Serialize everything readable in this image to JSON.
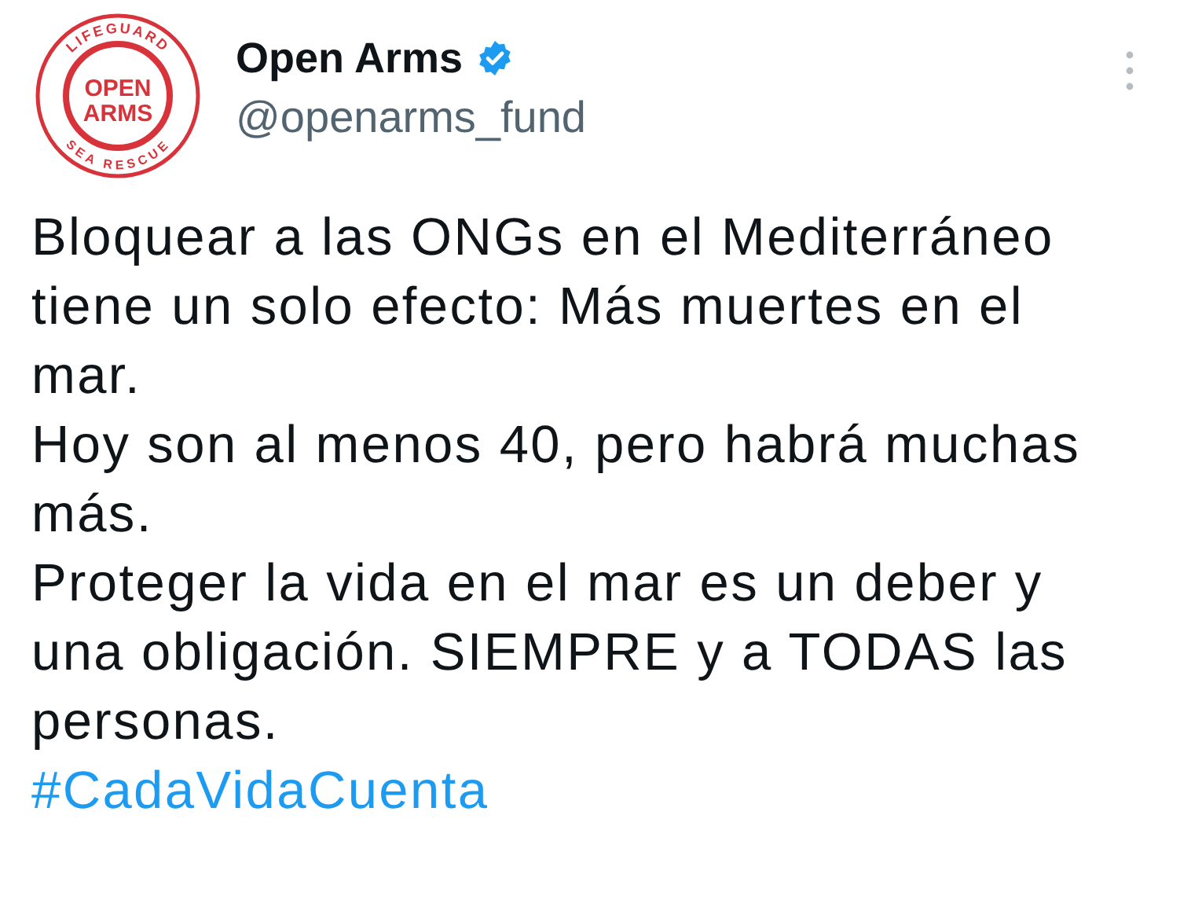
{
  "author": {
    "logo": {
      "top_ring": "LIFEGUARD",
      "bottom_ring": "SEA RESCUE",
      "line_1": "OPEN",
      "line_2": "ARMS"
    },
    "name": "Open Arms",
    "verified": true,
    "handle": "@openarms_fund"
  },
  "paragraphs": [
    "Bloquear a las ONGs en el Mediterráneo tiene un solo efecto: Más muertes en el mar.",
    "Hoy son al menos 40, pero habrá muchas más.",
    "Proteger la vida en el mar es un deber y una obligación. SIEMPRE y a TODAS las personas."
  ],
  "hashtag": "#CadaVidaCuenta"
}
